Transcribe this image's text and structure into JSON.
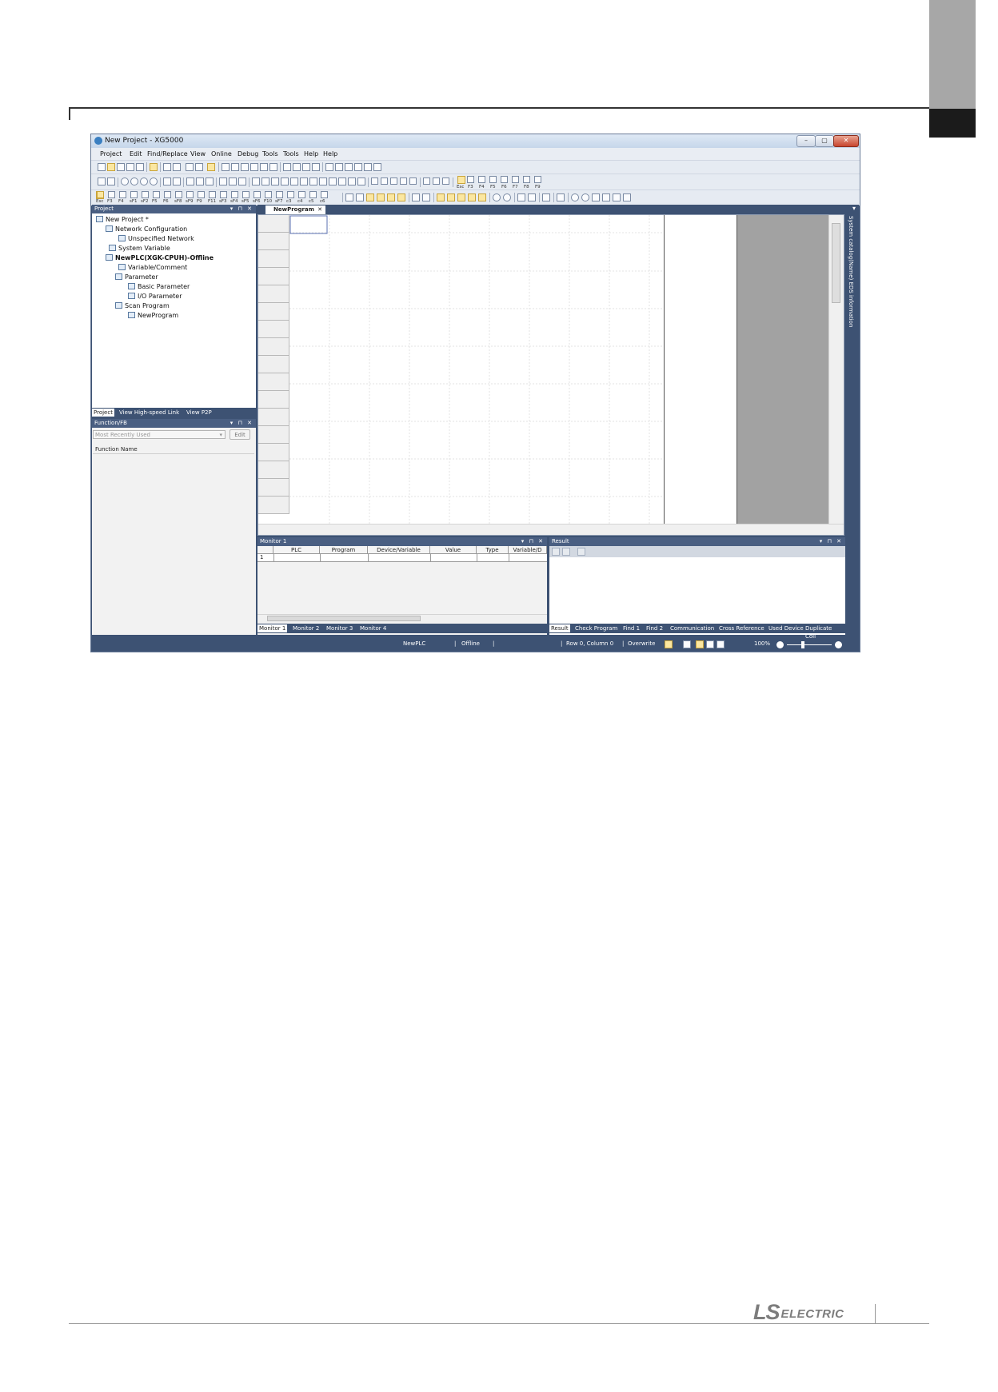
{
  "window": {
    "title": "New Project - XG5000"
  },
  "menu": [
    "Project",
    "Edit",
    "Find/Replace",
    "View",
    "Online",
    "Debug",
    "Tools",
    "Tools",
    "Help",
    "Help"
  ],
  "toolbar_fkeys": {
    "row2": [
      "Esc",
      "F3",
      "F4",
      "sF1",
      "sF2",
      "F5",
      "F6",
      "sF8",
      "sF9",
      "F9",
      "F11",
      "sF3",
      "sF4",
      "sF5",
      "sF6",
      "F10",
      "sF7",
      "c3",
      "c4",
      "c5",
      "c6"
    ],
    "row1_right": [
      "Esc",
      "F3",
      "F4",
      "F5",
      "F6",
      "F7",
      "F8",
      "F9"
    ]
  },
  "project_panel": {
    "title": "Project",
    "tree": [
      {
        "label": "New Project *",
        "depth": 0
      },
      {
        "label": "Network Configuration",
        "depth": 1
      },
      {
        "label": "Unspecified Network",
        "depth": 2
      },
      {
        "label": "System Variable",
        "depth": 1
      },
      {
        "label": "NewPLC(XGK-CPUH)-Offline",
        "depth": 1
      },
      {
        "label": "Variable/Comment",
        "depth": 2
      },
      {
        "label": "Parameter",
        "depth": 2
      },
      {
        "label": "Basic Parameter",
        "depth": 3
      },
      {
        "label": "I/O Parameter",
        "depth": 3
      },
      {
        "label": "Scan Program",
        "depth": 2
      },
      {
        "label": "NewProgram",
        "depth": 3
      }
    ],
    "tabs": [
      "Project",
      "View High-speed Link",
      "View P2P"
    ]
  },
  "function_panel": {
    "title": "Function/FB",
    "dropdown_value": "Most Recently Used",
    "edit_label": "Edit",
    "column_header": "Function Name"
  },
  "editor": {
    "tab": "NewProgram",
    "side_label": "System catalog(Name) EDS information"
  },
  "monitor": {
    "title": "Monitor 1",
    "columns": [
      "PLC",
      "Program",
      "Device/Variable",
      "Value",
      "Type",
      "Variable/D"
    ],
    "row1": "1",
    "tabs": [
      "Monitor 1",
      "Monitor 2",
      "Monitor 3",
      "Monitor 4"
    ]
  },
  "result": {
    "title": "Result",
    "tabs": [
      "Result",
      "Check Program",
      "Find 1",
      "Find 2",
      "Communication",
      "Cross Reference",
      "Used Device",
      "Duplicate Coil"
    ]
  },
  "statusbar": {
    "plc": "NewPLC",
    "mode": "Offline",
    "position": "Row 0, Column 0",
    "insert_mode": "Overwrite",
    "zoom": "100%"
  },
  "brand": {
    "ls": "LS",
    "electric": "ELECTRIC"
  },
  "colors": {
    "chrome": "#3d5273",
    "panel_title": "#4a5f82",
    "page_tab_gray": "#a7a7a7",
    "page_tab_black": "#1b1b1b"
  }
}
